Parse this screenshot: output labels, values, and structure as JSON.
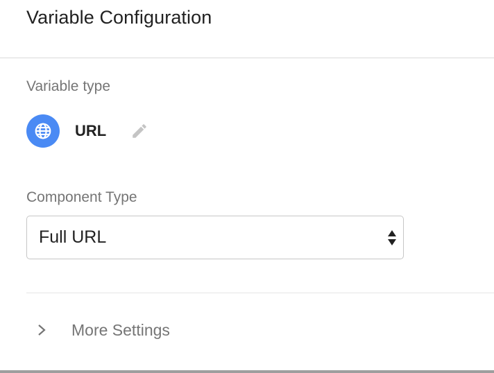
{
  "header": {
    "title": "Variable Configuration"
  },
  "variable_type": {
    "label": "Variable type",
    "icon": "globe-icon",
    "icon_color": "#4a8af4",
    "name": "URL",
    "edit_icon": "pencil-icon"
  },
  "component_type": {
    "label": "Component Type",
    "selected": "Full URL"
  },
  "more_settings": {
    "label": "More Settings",
    "icon": "chevron-right-icon"
  }
}
